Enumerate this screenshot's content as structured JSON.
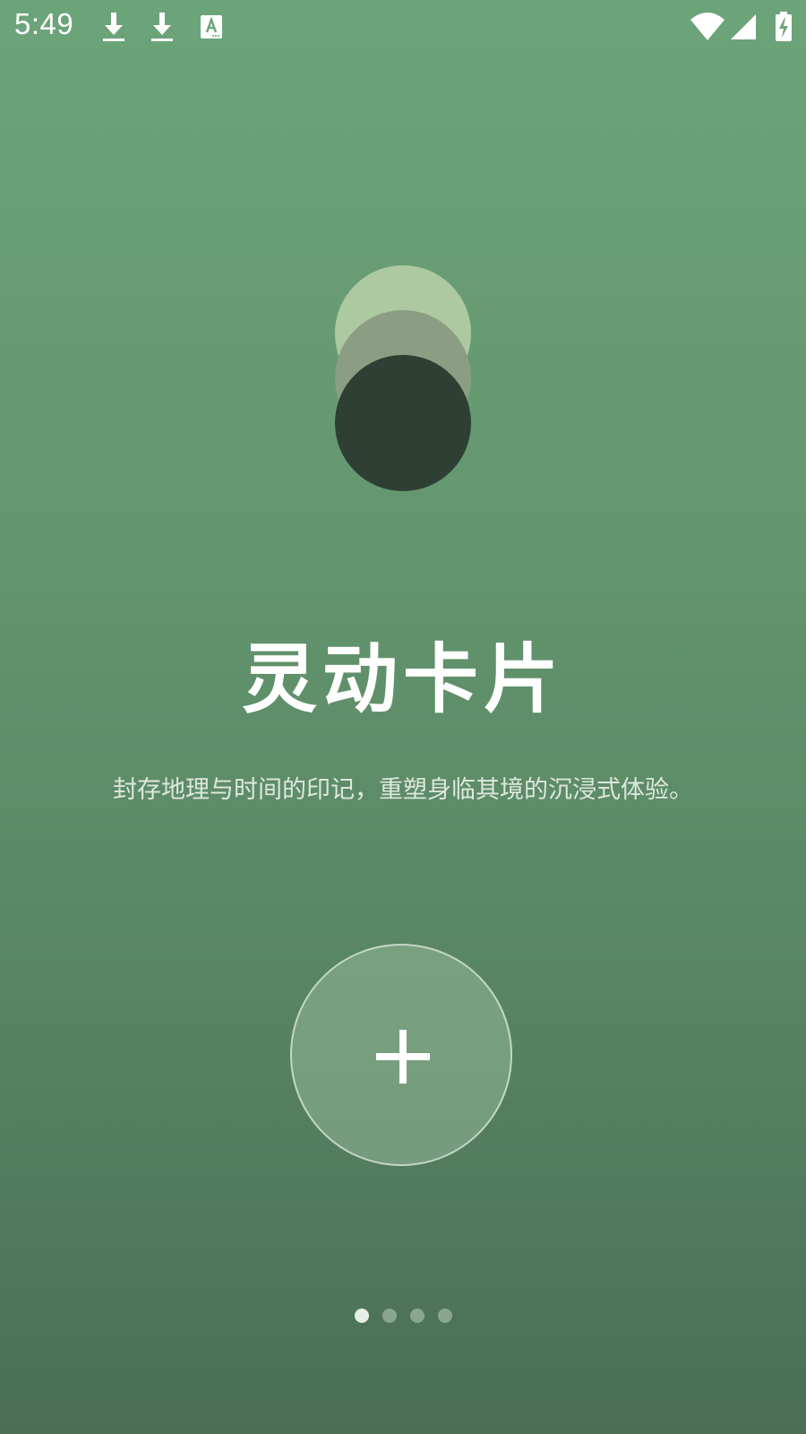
{
  "status_bar": {
    "time": "5:49",
    "icons": [
      "download-icon",
      "download-icon",
      "text-recognition-icon",
      "wifi-icon",
      "cell-signal-icon",
      "battery-charging-icon"
    ]
  },
  "logo": {
    "icon": "stacked-circles-logo-icon",
    "colors": [
      "#adc9a1",
      "#8b9e84",
      "#2f3f33"
    ]
  },
  "onboarding": {
    "title": "灵动卡片",
    "subtitle": "封存地理与时间的印记，重塑身临其境的沉浸式体验。"
  },
  "add_button": {
    "icon": "plus-icon"
  },
  "pager": {
    "total_pages": 4,
    "current_page": 1
  },
  "theme": {
    "background_top": "#6ca47a",
    "background_bottom": "#4b6e55",
    "text": "#ffffff"
  }
}
